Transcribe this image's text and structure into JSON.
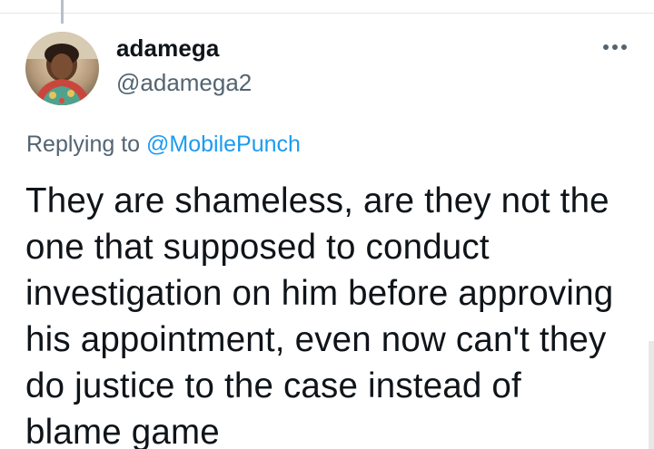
{
  "tweet": {
    "display_name": "adamega",
    "handle": "@adamega2",
    "replying_prefix": "Replying to",
    "replying_to": "@MobilePunch",
    "text": "They are shameless, are they not the one that supposed to conduct investigation on him before approving his appointment, even now can't they do justice to the case instead of blame game"
  },
  "icons": {
    "more": "more-options-icon",
    "avatar": "user-avatar"
  },
  "colors": {
    "text": "#0f1419",
    "secondary": "#536471",
    "link": "#1d9bf0"
  }
}
